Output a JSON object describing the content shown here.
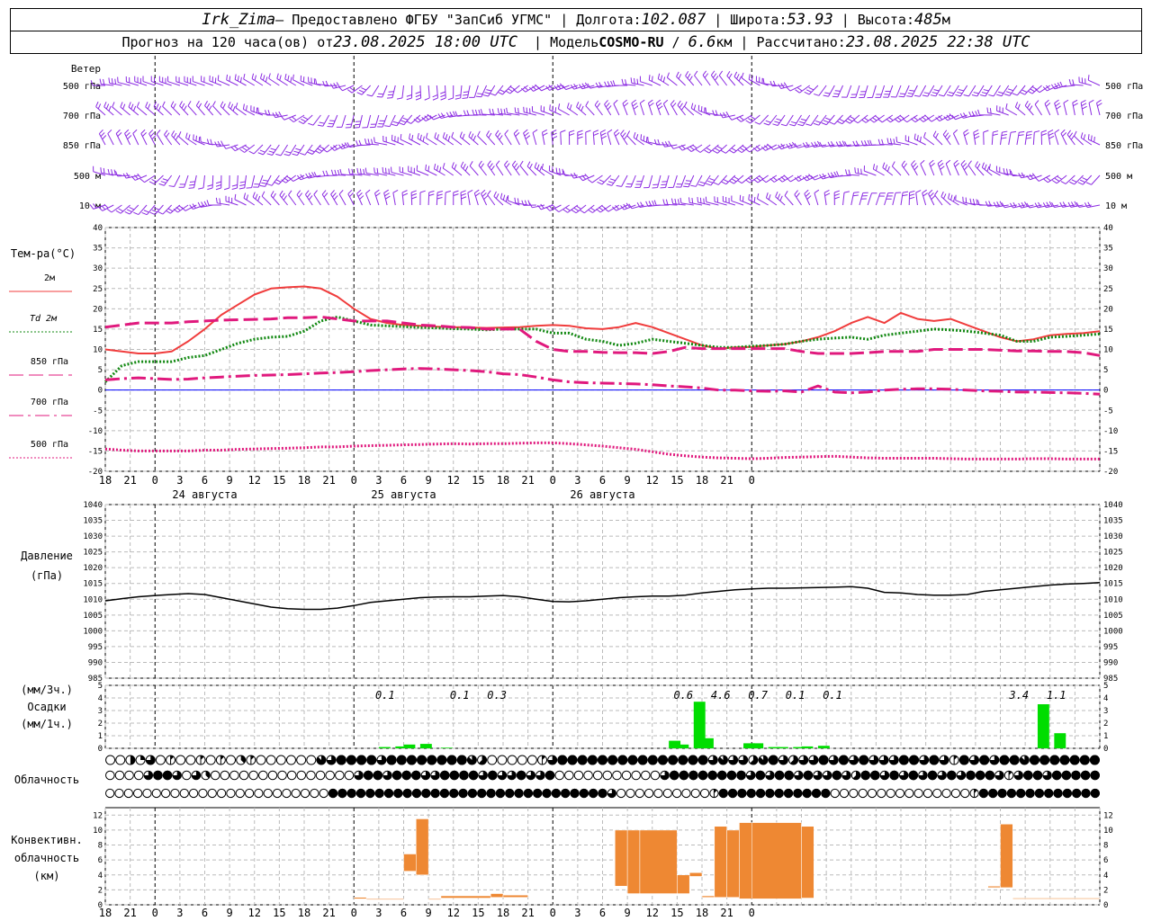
{
  "header": {
    "station": "Irk_Zima",
    "provider": " – Предоставлено ФГБУ \"ЗапСиб УГМС\"",
    "lon_label": "Долгота: ",
    "lon": "102.087",
    "lat_label": "Широта: ",
    "lat": "53.93",
    "alt_label": "Высота: ",
    "alt": "485",
    "alt_unit": "м",
    "forecast_prefix": "Прогноз на 120 часа(ов) от ",
    "forecast_time": "23.08.2025 18:00 UTC",
    "model_label": "Модель ",
    "model": "COSMO-RU",
    "resolution": "6.6",
    "res_unit": "км",
    "calc_label": "Рассчитано: ",
    "calc_time": "23.08.2025 22:38 UTC"
  },
  "chart_data": {
    "time_ticks": [
      "18",
      "21",
      "0",
      "3",
      "6",
      "9",
      "12",
      "15",
      "18",
      "21",
      "0",
      "3",
      "6",
      "9",
      "12",
      "15",
      "18",
      "21",
      "0",
      "3",
      "6",
      "9",
      "12",
      "15",
      "18",
      "21",
      "0"
    ],
    "day_labels": [
      "24 августа",
      "25 августа",
      "26 августа"
    ],
    "wind_panel": {
      "title": "Ветер",
      "levels": [
        "500 гПа",
        "700 гПа",
        "850 гПа",
        "500 м",
        "10 м"
      ],
      "color": "#8b2be2"
    },
    "temperature": {
      "type": "line",
      "title": "Тем-ра(°C)",
      "ylim": [
        -20,
        40
      ],
      "yticks": [
        40,
        35,
        30,
        25,
        20,
        15,
        10,
        5,
        0,
        -5,
        -10,
        -15,
        -20
      ],
      "zero_line_color": "#0000ff",
      "series": [
        {
          "name": "2м",
          "color": "#f03c3c",
          "style": "solid",
          "values": [
            10,
            9.5,
            9,
            9,
            9.5,
            12,
            15,
            18.5,
            21,
            23.5,
            25,
            25.3,
            25.5,
            25,
            23,
            20,
            17.5,
            16.5,
            16,
            15.8,
            15.6,
            15.5,
            15.4,
            15.3,
            15.4,
            15.5,
            15.8,
            16,
            15.8,
            15.2,
            15,
            15.5,
            16.5,
            15.5,
            14,
            12.5,
            11,
            10.2,
            10.5,
            10.6,
            11,
            11.3,
            12,
            13,
            14.5,
            16.5,
            18,
            16.5,
            19,
            17.5,
            17,
            17.5,
            16,
            14.5,
            13,
            12,
            12.5,
            13.5,
            13.8,
            14,
            14.5
          ]
        },
        {
          "name": "Td 2м",
          "color": "#118811",
          "style": "dotted",
          "values": [
            2,
            6,
            7,
            7,
            7,
            8,
            8.5,
            10,
            11.5,
            12.5,
            13,
            13.2,
            14.5,
            17,
            18,
            17,
            16,
            15.8,
            15.6,
            15.4,
            15.3,
            15.1,
            15,
            14.8,
            15,
            15,
            15,
            14,
            14,
            12.5,
            12,
            11,
            11.5,
            12.5,
            12,
            11.5,
            11,
            10.5,
            10.5,
            10.8,
            11,
            11.3,
            12,
            12.5,
            12.8,
            13,
            12.5,
            13.5,
            14,
            14.5,
            15,
            14.8,
            14.5,
            14,
            13.5,
            12,
            12,
            13,
            13.2,
            13.5,
            13.8
          ]
        },
        {
          "name": "850 гПа",
          "color": "#e0197d",
          "style": "dashed",
          "values": [
            15.5,
            16,
            16.5,
            16.5,
            16.5,
            16.8,
            17,
            17.2,
            17.3,
            17.4,
            17.5,
            17.8,
            17.8,
            18,
            17.5,
            17,
            17,
            17,
            16.5,
            16,
            15.8,
            15.5,
            15.4,
            15,
            15,
            15,
            12,
            10,
            9.5,
            9.5,
            9.3,
            9.2,
            9.2,
            9,
            9.5,
            10.5,
            10.2,
            10.2,
            10.2,
            10.2,
            10.2,
            10.2,
            9.5,
            9,
            9,
            9,
            9.2,
            9.5,
            9.5,
            9.5,
            10,
            10,
            10,
            10,
            9.8,
            9.6,
            9.6,
            9.5,
            9.5,
            9.2,
            8.5
          ]
        },
        {
          "name": "700 гПа",
          "color": "#e0197d",
          "style": "dashdot",
          "values": [
            2.5,
            2.8,
            3,
            2.8,
            2.6,
            2.7,
            3,
            3.2,
            3.4,
            3.6,
            3.7,
            3.8,
            4,
            4.2,
            4.3,
            4.5,
            4.8,
            5,
            5.2,
            5.3,
            5.2,
            5,
            4.8,
            4.5,
            4,
            3.8,
            3.2,
            2.5,
            2,
            1.8,
            1.7,
            1.6,
            1.5,
            1.3,
            1,
            0.8,
            0.5,
            0,
            0,
            -0.2,
            -0.3,
            -0.2,
            -0.5,
            1,
            -0.5,
            -0.7,
            -0.5,
            0,
            0.2,
            0.3,
            0.3,
            0.2,
            0,
            -0.2,
            -0.3,
            -0.5,
            -0.5,
            -0.6,
            -0.7,
            -0.8,
            -1
          ]
        },
        {
          "name": "500 гПа",
          "color": "#e0197d",
          "style": "densedot",
          "values": [
            -14.5,
            -14.8,
            -15,
            -15,
            -15,
            -15,
            -14.8,
            -14.8,
            -14.6,
            -14.5,
            -14.4,
            -14.3,
            -14.2,
            -14,
            -14,
            -13.8,
            -13.7,
            -13.6,
            -13.5,
            -13.4,
            -13.3,
            -13.2,
            -13.3,
            -13.2,
            -13.2,
            -13.1,
            -13,
            -13,
            -13.2,
            -13.5,
            -13.8,
            -14.2,
            -14.6,
            -15.2,
            -15.8,
            -16.2,
            -16.5,
            -16.7,
            -16.8,
            -16.9,
            -16.8,
            -16.6,
            -16.5,
            -16.4,
            -16.3,
            -16.5,
            -16.7,
            -16.8,
            -16.8,
            -16.8,
            -16.8,
            -16.9,
            -17,
            -17,
            -17,
            -17,
            -16.9,
            -16.9,
            -17,
            -17,
            -17
          ]
        }
      ]
    },
    "pressure": {
      "type": "line",
      "title": "Давление",
      "unit": "(гПа)",
      "ylim": [
        985,
        1040
      ],
      "yticks": [
        1040,
        1035,
        1030,
        1025,
        1020,
        1015,
        1010,
        1005,
        1000,
        995,
        990,
        985
      ],
      "color": "#000000",
      "values": [
        1009.5,
        1010.2,
        1010.8,
        1011.2,
        1011.5,
        1011.8,
        1011.5,
        1010.5,
        1009.5,
        1008.5,
        1007.5,
        1007,
        1006.8,
        1006.8,
        1007.2,
        1008,
        1009,
        1009.5,
        1010,
        1010.5,
        1010.7,
        1010.8,
        1010.8,
        1011,
        1011.2,
        1010.8,
        1010,
        1009.3,
        1009.2,
        1009.5,
        1010,
        1010.5,
        1010.8,
        1011,
        1011,
        1011.3,
        1012,
        1012.5,
        1013,
        1013.3,
        1013.5,
        1013.5,
        1013.6,
        1013.7,
        1013.8,
        1014,
        1013.5,
        1012.2,
        1012,
        1011.5,
        1011.3,
        1011.3,
        1011.5,
        1012.5,
        1013,
        1013.5,
        1014,
        1014.5,
        1014.8,
        1015,
        1015.3
      ]
    },
    "precip": {
      "type": "bar",
      "title": "Осадки",
      "unit_3h": "(мм/3ч.)",
      "unit_1h": "(мм/1ч.)",
      "ylim": [
        0,
        5
      ],
      "yticks": [
        5,
        4,
        3,
        2,
        1,
        0
      ],
      "color": "#00dd00",
      "labels": [
        "0.1",
        "0.1",
        "0.3",
        "0.6",
        "4.6",
        "0.7",
        "0.1",
        "0.1",
        "3.4",
        "1.1"
      ],
      "label_hours": [
        22.5,
        28.5,
        31.5,
        46.5,
        49.5,
        52.5,
        55.5,
        58.5,
        73.5,
        76.5
      ],
      "bars": [
        [
          30,
          0.1
        ],
        [
          31,
          0.15
        ],
        [
          32,
          0.3
        ],
        [
          33,
          0.35
        ],
        [
          35,
          0.05
        ],
        [
          47,
          0.6
        ],
        [
          48,
          0.3
        ],
        [
          49,
          3.7
        ],
        [
          50,
          0.8
        ],
        [
          52,
          0.4
        ],
        [
          53,
          0.4
        ],
        [
          54,
          0.1
        ],
        [
          55,
          0.1
        ],
        [
          56,
          0.1
        ],
        [
          57,
          0.15
        ],
        [
          58,
          0.2
        ],
        [
          75,
          3.5
        ],
        [
          76,
          1.2
        ]
      ],
      "bar_hours": [
        22,
        23,
        24,
        25,
        27,
        45,
        46,
        47,
        48,
        51,
        52,
        53,
        54,
        55,
        56,
        57,
        75,
        76
      ]
    },
    "clouds": {
      "title": "Облачность",
      "rows": [
        [
          0,
          0,
          4,
          2,
          6,
          0,
          1,
          0,
          0,
          1,
          0,
          1,
          0,
          3,
          1,
          0,
          0,
          0,
          0,
          0,
          0,
          7,
          6,
          8,
          8,
          8,
          8,
          6,
          8,
          8,
          8,
          8,
          8,
          8,
          8,
          8,
          7,
          5,
          0,
          0,
          0,
          0,
          0,
          1,
          6,
          8,
          8,
          8,
          8,
          8,
          8,
          8,
          8,
          8,
          8,
          8,
          8,
          8,
          8,
          8,
          6,
          7,
          6,
          6,
          5,
          7,
          8,
          6,
          5,
          6,
          6,
          8,
          6,
          8,
          6,
          8,
          6,
          6,
          6,
          8,
          8,
          6,
          8,
          6,
          1,
          8,
          6,
          8,
          6,
          8,
          8,
          7,
          8,
          8,
          8,
          8,
          8,
          8,
          8
        ],
        [
          0,
          0,
          0,
          0,
          6,
          8,
          8,
          6,
          0,
          6,
          3,
          0,
          0,
          0,
          0,
          0,
          0,
          0,
          0,
          0,
          0,
          0,
          0,
          0,
          0,
          0,
          6,
          8,
          8,
          6,
          8,
          8,
          8,
          6,
          6,
          8,
          8,
          8,
          8,
          6,
          8,
          6,
          6,
          8,
          6,
          6,
          8,
          0,
          0,
          0,
          0,
          0,
          0,
          0,
          0,
          0,
          0,
          0,
          6,
          8,
          8,
          8,
          8,
          8,
          8,
          8,
          8,
          6,
          8,
          6,
          8,
          8,
          6,
          8,
          6,
          6,
          8,
          6,
          5,
          8,
          8,
          6,
          8,
          6,
          8,
          6,
          8,
          6,
          8,
          6,
          8,
          8,
          8,
          6,
          1,
          6,
          8,
          8,
          6,
          8,
          8,
          8,
          8,
          8
        ],
        [
          0,
          0,
          0,
          0,
          0,
          0,
          0,
          0,
          0,
          0,
          0,
          0,
          0,
          0,
          0,
          0,
          0,
          0,
          0,
          0,
          0,
          0,
          0,
          0,
          8,
          8,
          8,
          8,
          8,
          8,
          8,
          8,
          8,
          8,
          8,
          8,
          8,
          8,
          8,
          8,
          8,
          8,
          8,
          8,
          8,
          8,
          8,
          8,
          8,
          8,
          8,
          8,
          8,
          8,
          6,
          0,
          0,
          0,
          0,
          0,
          0,
          0,
          0,
          0,
          0,
          1,
          8,
          8,
          8,
          8,
          8,
          8,
          8,
          8,
          8,
          8,
          8,
          8,
          0,
          0,
          0,
          0,
          0,
          0,
          0,
          0,
          0,
          0,
          0,
          0,
          0,
          0,
          0,
          1,
          8,
          8,
          8,
          8,
          8,
          8,
          8,
          8,
          8,
          8,
          8,
          8,
          8
        ]
      ]
    },
    "convective": {
      "type": "bar",
      "title": [
        "Конвективн.",
        "облачность",
        "(км)"
      ],
      "ylim": [
        0,
        13
      ],
      "yticks": [
        12,
        10,
        8,
        6,
        4,
        2,
        0
      ],
      "color": "#ee8833",
      "segments": [
        [
          20,
          21,
          0.8,
          1
        ],
        [
          21,
          24,
          0.8,
          0.8
        ],
        [
          24,
          25,
          4.5,
          6.8
        ],
        [
          25,
          26,
          4,
          11.5
        ],
        [
          26,
          27,
          0.8,
          0.8
        ],
        [
          27,
          31,
          0.9,
          1.2
        ],
        [
          31,
          32,
          1,
          1.5
        ],
        [
          32,
          34,
          1,
          1.3
        ],
        [
          41,
          42,
          2.5,
          10
        ],
        [
          42,
          43,
          1.5,
          10
        ],
        [
          43,
          46,
          1.5,
          10
        ],
        [
          46,
          47,
          1.5,
          4
        ],
        [
          47,
          48,
          3.8,
          4.3
        ],
        [
          48,
          49,
          1,
          1.2
        ],
        [
          49,
          50,
          1,
          10.5
        ],
        [
          50,
          51,
          1,
          10
        ],
        [
          51,
          52,
          0.8,
          11
        ],
        [
          52,
          56,
          0.8,
          11
        ],
        [
          56,
          57,
          0.9,
          10.5
        ],
        [
          71,
          72,
          2.3,
          2.5
        ],
        [
          72,
          73,
          2.3,
          10.8
        ],
        [
          73,
          80,
          0.8,
          0.9
        ]
      ]
    }
  }
}
